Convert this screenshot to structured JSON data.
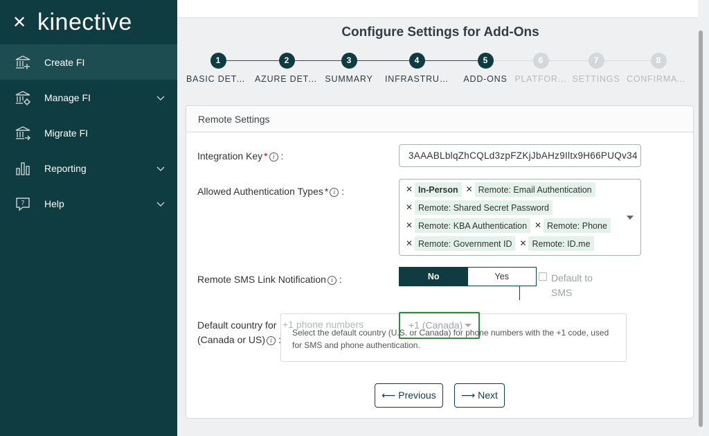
{
  "sidebar": {
    "logo": "kinective",
    "close_glyph": "✕",
    "items": [
      {
        "label": "Create FI",
        "icon": "bank-plus-icon",
        "expandable": false,
        "active": true
      },
      {
        "label": "Manage FI",
        "icon": "bank-gear-icon",
        "expandable": true,
        "active": false
      },
      {
        "label": "Migrate FI",
        "icon": "bank-arrow-icon",
        "expandable": false,
        "active": false
      },
      {
        "label": "Reporting",
        "icon": "bar-chart-icon",
        "expandable": true,
        "active": false
      },
      {
        "label": "Help",
        "icon": "help-bubble-icon",
        "expandable": true,
        "active": false
      }
    ]
  },
  "page": {
    "title": "Configure Settings for Add-Ons"
  },
  "stepper": {
    "steps": [
      {
        "num": "1",
        "label": "BASIC DETA...",
        "state": "done"
      },
      {
        "num": "2",
        "label": "AZURE DETA...",
        "state": "done"
      },
      {
        "num": "3",
        "label": "SUMMARY",
        "state": "done"
      },
      {
        "num": "4",
        "label": "INFRASTRUCT...",
        "state": "done"
      },
      {
        "num": "5",
        "label": "ADD-ONS",
        "state": "current"
      },
      {
        "num": "6",
        "label": "PLATFOR...",
        "state": "pending"
      },
      {
        "num": "7",
        "label": "SETTINGS",
        "state": "pending"
      },
      {
        "num": "8",
        "label": "CONFIRMATI...",
        "state": "pending"
      }
    ]
  },
  "card": {
    "title": "Remote Settings",
    "integration_key": {
      "label": "Integration Key",
      "required": "*",
      "suffix": ":",
      "value": "3AAABLblqZhCQLd3zpFZKjJbAHz9Iltx9H66PUQv34"
    },
    "auth_types": {
      "label": "Allowed Authentication Types",
      "required": "*",
      "suffix": ":",
      "tags": [
        "In-Person",
        "Remote: Email Authentication",
        "Remote: Shared Secret Password",
        "Remote: KBA Authentication",
        "Remote: Phone",
        "Remote: Government ID",
        "Remote: ID.me"
      ]
    },
    "sms": {
      "label": "Remote SMS Link Notification",
      "suffix": ":",
      "options": [
        "No",
        "Yes"
      ],
      "selected": "No",
      "default_checkbox_label": "Default to SMS",
      "default_checked": false
    },
    "country": {
      "label_line1": "Default country for",
      "label_line2": "(Canada or US)",
      "suffix": ":",
      "ghost_text": "+1 phone numbers",
      "value": "+1 (Canada)",
      "tooltip": "Select the default country (U.S. or Canada) for phone numbers with the +1 code, used for SMS and phone authentication."
    },
    "buttons": {
      "previous": "Previous",
      "next": "Next"
    }
  },
  "colors": {
    "sidebar_bg": "#0f3c40",
    "accent": "#0f3c40",
    "required": "#d0021b",
    "tag_bg": "#e4f2ec",
    "focus_border": "#2e8b3f"
  }
}
